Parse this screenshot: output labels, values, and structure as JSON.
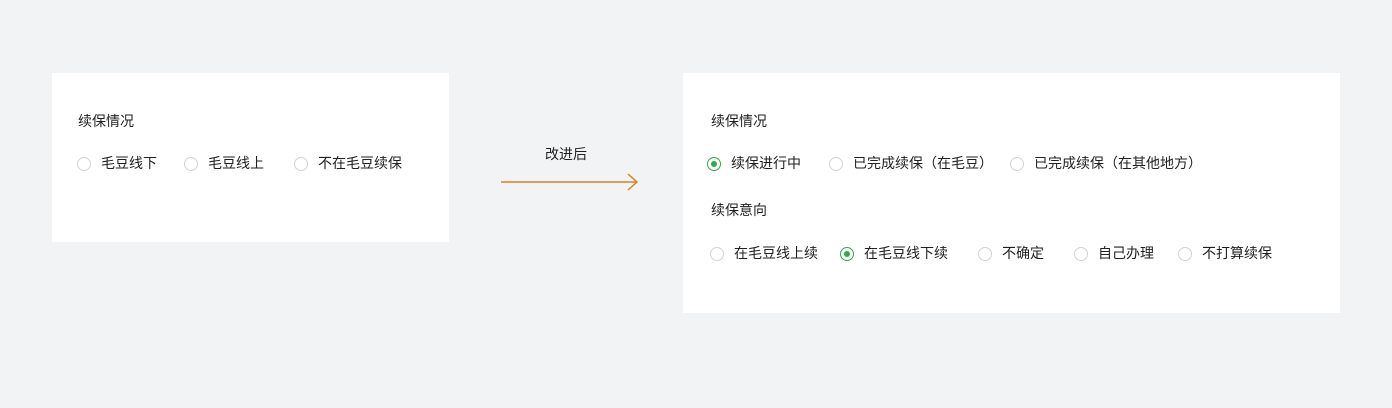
{
  "before": {
    "title": "续保情况",
    "options": [
      "毛豆线下",
      "毛豆线上",
      "不在毛豆续保"
    ]
  },
  "arrow": {
    "label": "改进后",
    "color": "#d4852a"
  },
  "after": {
    "status": {
      "title": "续保情况",
      "options": [
        "续保进行中",
        "已完成续保（在毛豆）",
        "已完成续保（在其他地方）"
      ],
      "selected": "续保进行中"
    },
    "intent": {
      "title": "续保意向",
      "options": [
        "在毛豆线上续",
        "在毛豆线下续",
        "不确定",
        "自己办理",
        "不打算续保"
      ],
      "selected": "在毛豆线下续"
    }
  },
  "colors": {
    "background": "#f2f3f5",
    "card": "#ffffff",
    "radio_checked": "#2eaa4a",
    "radio_border": "#cfd3d8"
  }
}
